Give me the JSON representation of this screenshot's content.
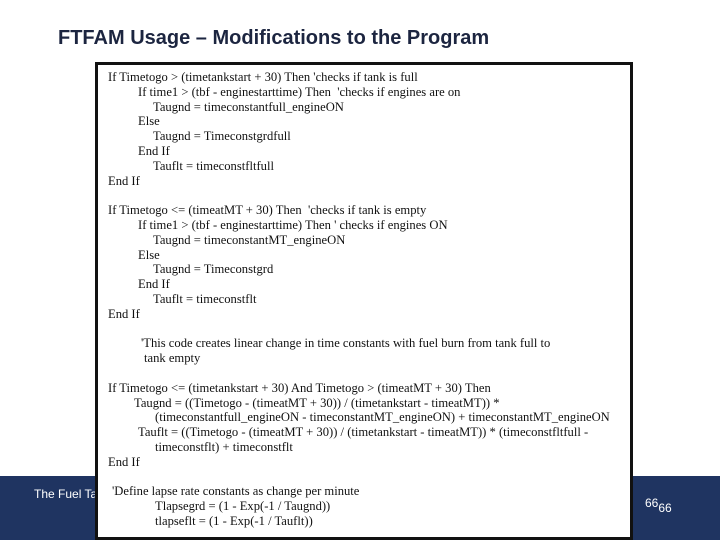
{
  "title": "FTFAM Usage – Modifications to the Program",
  "footer": {
    "text": "The Fuel Ta",
    "page": "66",
    "page_sub": "66"
  },
  "code": {
    "lines": [
      "If Timetogo > (timetankstart + 30) Then 'checks if tank is full",
      "If time1 > (tbf - enginestarttime) Then  'checks if engines are on",
      "Taugnd = timeconstantfull_engineON",
      "Else",
      "Taugnd = Timeconstgrdfull",
      "End If",
      "Tauflt = timeconstfltfull",
      "End If",
      "",
      "If Timetogo <= (timeatMT + 30) Then  'checks if tank is empty",
      "If time1 > (tbf - enginestarttime) Then ' checks if engines ON",
      "Taugnd = timeconstantMT_engineON",
      "Else",
      "Taugnd = Timeconstgrd",
      "End If",
      "Tauflt = timeconstflt",
      "End If",
      "",
      "'This code creates linear change in time constants with fuel burn from tank full to",
      "tank empty",
      "",
      "If Timetogo <= (timetankstart + 30) And Timetogo > (timeatMT + 30) Then",
      "Taugnd = ((Timetogo - (timeatMT + 30)) / (timetankstart - timeatMT)) *",
      "(timeconstantfull_engineON - timeconstantMT_engineON) + timeconstantMT_engineON",
      "Tauflt = ((Timetogo - (timeatMT + 30)) / (timetankstart - timeatMT)) * (timeconstfltfull -",
      "timeconstflt) + timeconstflt",
      "End If",
      "",
      "'Define lapse rate constants as change per minute",
      "Tlapsegrd = (1 - Exp(-1 / Taugnd))",
      "tlapseflt = (1 - Exp(-1 / Tauflt))"
    ]
  }
}
